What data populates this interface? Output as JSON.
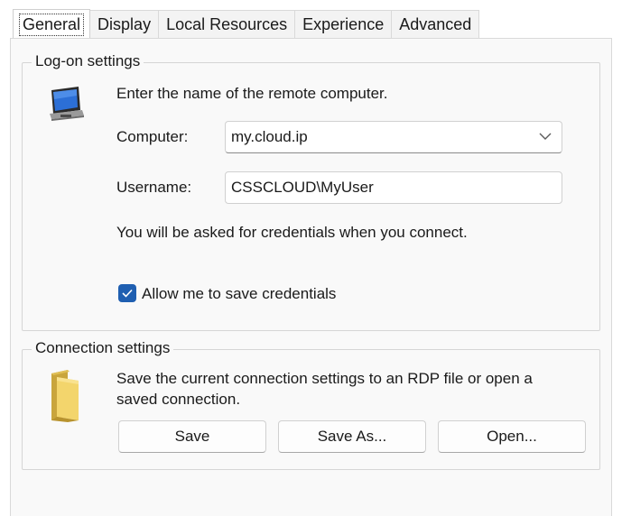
{
  "tabs": [
    {
      "label": "General",
      "active": true
    },
    {
      "label": "Display"
    },
    {
      "label": "Local Resources"
    },
    {
      "label": "Experience"
    },
    {
      "label": "Advanced"
    }
  ],
  "logon": {
    "group_label": "Log-on settings",
    "intro": "Enter the name of the remote computer.",
    "computer_label": "Computer:",
    "computer_value": "my.cloud.ip",
    "username_label": "Username:",
    "username_value": "CSSCLOUD\\MyUser",
    "credentials_note": "You will be asked for credentials when you connect.",
    "save_credentials_label": "Allow me to save credentials",
    "save_credentials_checked": true
  },
  "connection": {
    "group_label": "Connection settings",
    "description_line1": "Save the current connection settings to an RDP file or open a",
    "description_line2": "saved connection.",
    "save_button": "Save",
    "save_as_button": "Save As...",
    "open_button": "Open..."
  },
  "icons": {
    "computer": "monitor-icon",
    "folder": "folder-icon",
    "dropdown": "chevron-down-icon",
    "check": "check-icon"
  },
  "colors": {
    "accent": "#1f5fb1",
    "panel_bg": "#f9f9f9"
  }
}
